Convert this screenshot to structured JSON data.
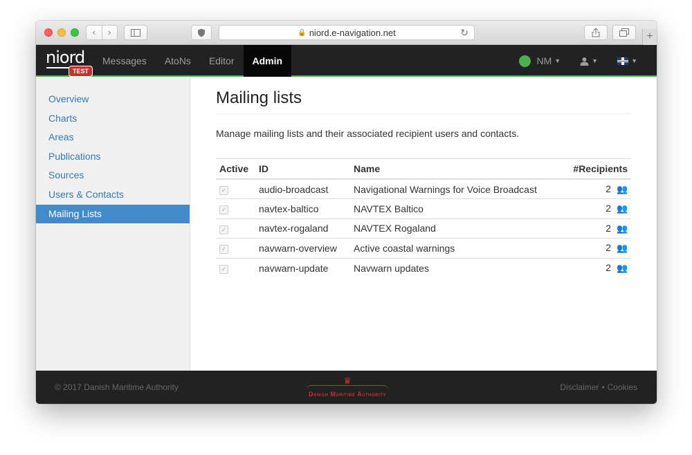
{
  "browser": {
    "url": "niord.e-navigation.net"
  },
  "brand": {
    "name": "Niord",
    "badge": "TEST"
  },
  "navbar": {
    "links": [
      "Messages",
      "AtoNs",
      "Editor",
      "Admin"
    ],
    "active": "Admin",
    "domain": "NM",
    "status_color": "#4caf50",
    "language": "English (UK flag)"
  },
  "sidebar": {
    "items": [
      {
        "label": "Overview"
      },
      {
        "label": "Charts"
      },
      {
        "label": "Areas"
      },
      {
        "label": "Publications"
      },
      {
        "label": "Sources"
      },
      {
        "label": "Users & Contacts"
      },
      {
        "label": "Mailing Lists"
      }
    ],
    "selected": "Mailing Lists"
  },
  "page": {
    "title": "Mailing lists",
    "description": "Manage mailing lists and their associated recipient users and contacts."
  },
  "table": {
    "headers": {
      "active": "Active",
      "id": "ID",
      "name": "Name",
      "recipients": "#Recipients"
    },
    "rows": [
      {
        "active": true,
        "id": "audio-broadcast",
        "name": "Navigational Warnings for Voice Broadcast",
        "recipients": "2"
      },
      {
        "active": true,
        "id": "navtex-baltico",
        "name": "NAVTEX Baltico",
        "recipients": "2"
      },
      {
        "active": true,
        "id": "navtex-rogaland",
        "name": "NAVTEX Rogaland",
        "recipients": "2"
      },
      {
        "active": true,
        "id": "navwarn-overview",
        "name": "Active coastal warnings",
        "recipients": "2"
      },
      {
        "active": true,
        "id": "navwarn-update",
        "name": "Navwarn updates",
        "recipients": "2"
      }
    ]
  },
  "footer": {
    "copyright": "© 2017 Danish Maritime Authority",
    "logo_text": "Danish Maritime Authority",
    "links": [
      "Disclaimer",
      "Cookies"
    ],
    "separator": "•"
  },
  "colors": {
    "accent": "#337ab7",
    "selected": "#428bca",
    "navbar": "#222222"
  }
}
